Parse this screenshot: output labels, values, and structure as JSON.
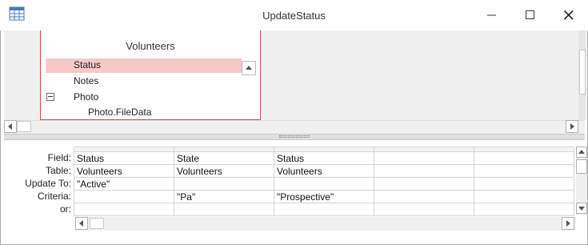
{
  "window": {
    "title": "UpdateStatus",
    "icon": "query-design-icon",
    "controls": [
      "minimize-icon",
      "maximize-icon",
      "close-icon"
    ]
  },
  "table_list": {
    "title": "Volunteers",
    "fields": [
      {
        "label": "Status",
        "selected": true
      },
      {
        "label": "Notes"
      },
      {
        "label": "Photo",
        "expandable": true,
        "expanded": true
      },
      {
        "label": "Photo.FileData",
        "indented": true
      }
    ]
  },
  "grid": {
    "row_labels": {
      "field": "Field:",
      "table": "Table:",
      "update_to": "Update To:",
      "criteria": "Criteria:",
      "or": "or:"
    },
    "columns": [
      {
        "field": "Status",
        "table": "Volunteers",
        "update_to": "\"Active\"",
        "criteria": "",
        "or": ""
      },
      {
        "field": "State",
        "table": "Volunteers",
        "update_to": "",
        "criteria": "\"Pa\"",
        "or": ""
      },
      {
        "field": "Status",
        "table": "Volunteers",
        "update_to": "",
        "criteria": "\"Prospective\"",
        "or": ""
      },
      {
        "field": "",
        "table": "",
        "update_to": "",
        "criteria": "",
        "or": ""
      },
      {
        "field": "",
        "table": "",
        "update_to": "",
        "criteria": "",
        "or": ""
      }
    ]
  },
  "colors": {
    "table_border": "#c94f4f",
    "selected_field": "#f6c8c8",
    "pane_background": "#f0f0f0"
  }
}
